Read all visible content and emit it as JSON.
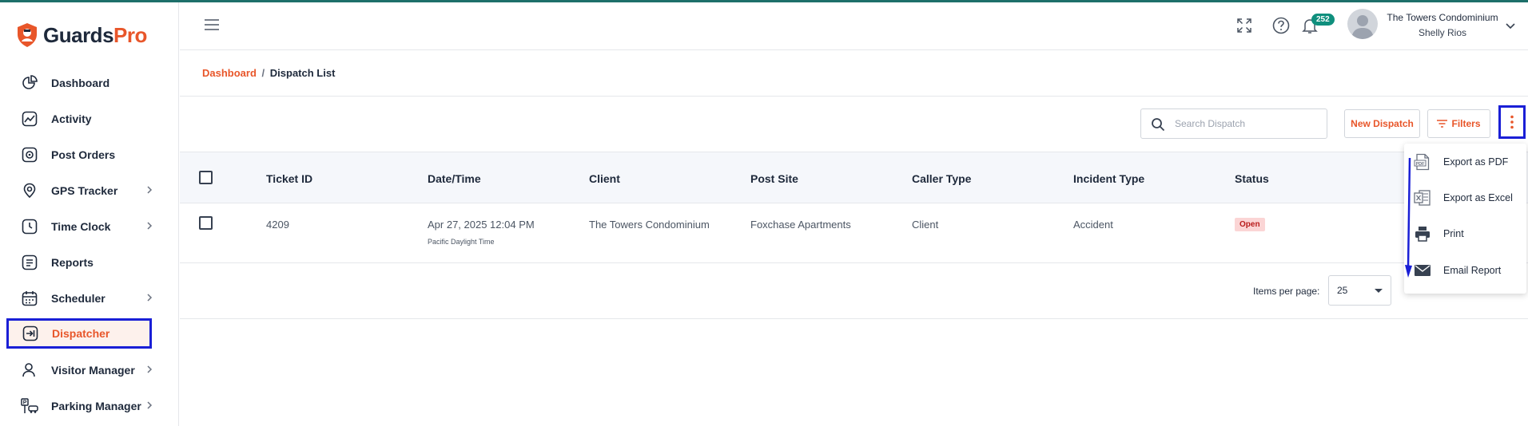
{
  "brand": {
    "name_part1": "Guards",
    "name_part2": "Pro"
  },
  "sidebar": {
    "items": [
      {
        "label": "Dashboard"
      },
      {
        "label": "Activity"
      },
      {
        "label": "Post Orders"
      },
      {
        "label": "GPS Tracker"
      },
      {
        "label": "Time Clock"
      },
      {
        "label": "Reports"
      },
      {
        "label": "Scheduler"
      },
      {
        "label": "Dispatcher"
      },
      {
        "label": "Visitor Manager"
      },
      {
        "label": "Parking Manager"
      }
    ]
  },
  "header": {
    "notification_count": "252",
    "organization": "The Towers Condominium",
    "user_name": "Shelly Rios"
  },
  "breadcrumb": {
    "home": "Dashboard",
    "separator": "/",
    "current": "Dispatch List"
  },
  "toolbar": {
    "search_placeholder": "Search Dispatch",
    "new_dispatch": "New Dispatch",
    "filters": "Filters"
  },
  "table": {
    "columns": [
      "Ticket ID",
      "Date/Time",
      "Client",
      "Post Site",
      "Caller Type",
      "Incident Type",
      "Status"
    ],
    "rows": [
      {
        "ticket_id": "4209",
        "date_time": "Apr 27, 2025 12:04 PM",
        "timezone": "Pacific Daylight Time",
        "client": "The Towers Condominium",
        "post_site": "Foxchase Apartments",
        "caller_type": "Client",
        "incident_type": "Accident",
        "status": "Open"
      }
    ]
  },
  "pagination": {
    "items_per_page_label": "Items per page:",
    "items_per_page": "25"
  },
  "export_menu": {
    "items": [
      {
        "label": "Export as PDF",
        "icon": "pdf-icon"
      },
      {
        "label": "Export as Excel",
        "icon": "excel-icon"
      },
      {
        "label": "Print",
        "icon": "printer-icon"
      },
      {
        "label": "Email Report",
        "icon": "mail-icon"
      }
    ]
  },
  "colors": {
    "brand_orange": "#e8562a",
    "annotation_blue": "#1a1fd6",
    "badge_teal": "#0f8f7d",
    "status_open_bg": "#fbd5d5"
  }
}
